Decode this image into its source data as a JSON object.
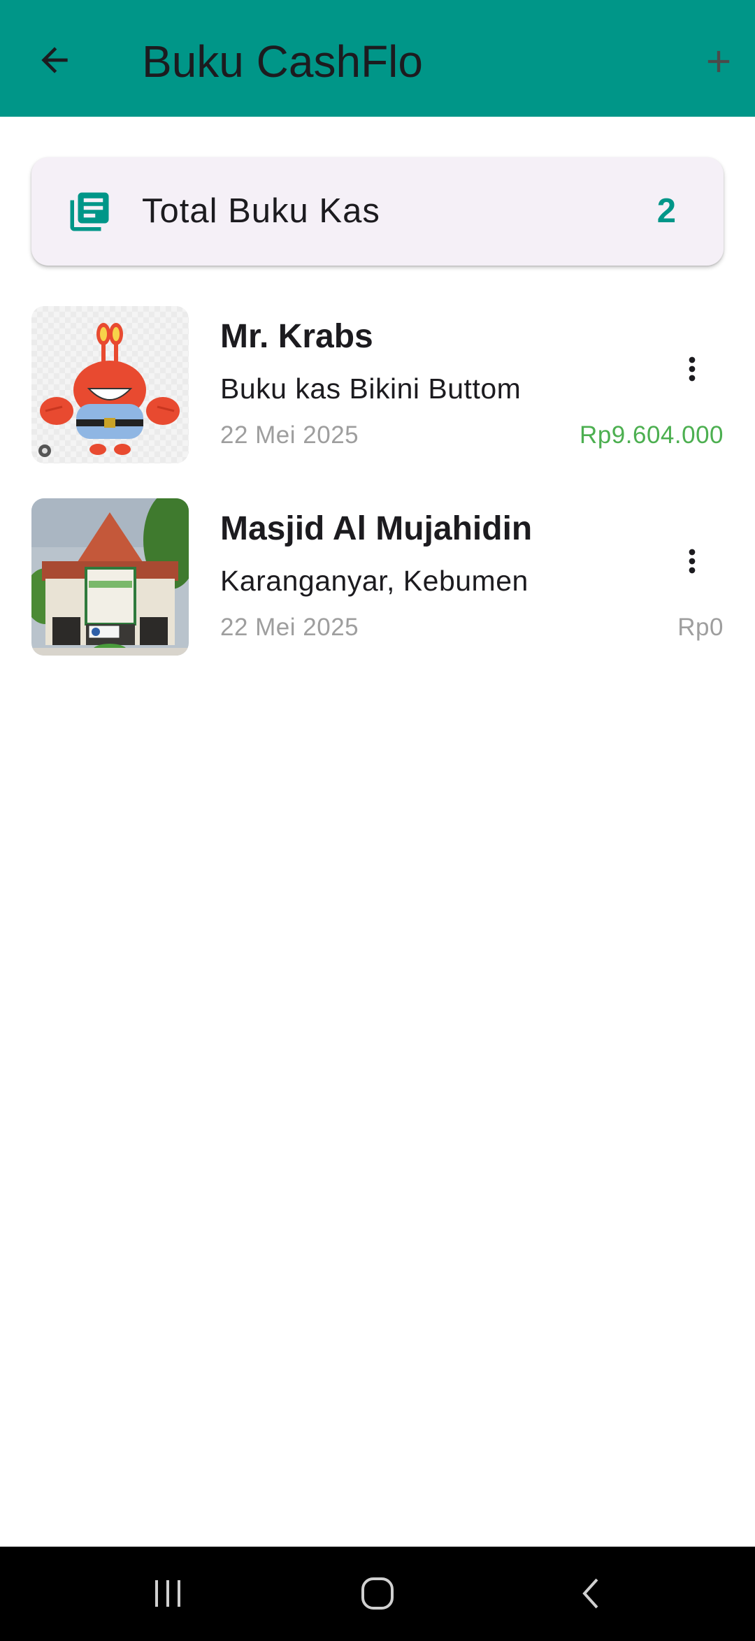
{
  "app_bar": {
    "title": "Buku CashFlo",
    "background_color": "#009688",
    "back_icon": "arrow-left-icon",
    "add_icon": "plus-icon"
  },
  "summary": {
    "icon": "library-books-icon",
    "label": "Total Buku Kas",
    "count": "2",
    "accent_color": "#009688"
  },
  "cashbooks": [
    {
      "thumbnail": "mr-krabs-cartoon-image",
      "name": "Mr. Krabs",
      "description": "Buku kas Bikini Buttom",
      "date": "22 Mei 2025",
      "balance": "Rp9.604.000",
      "balance_color": "#4caf50",
      "menu_icon": "more-vertical-icon"
    },
    {
      "thumbnail": "mosque-building-photo",
      "name": "Masjid Al Mujahidin",
      "description": "Karanganyar, Kebumen",
      "date": "22 Mei 2025",
      "balance": "Rp0",
      "balance_color": "#9e9e9e",
      "menu_icon": "more-vertical-icon"
    }
  ],
  "system_nav": {
    "recents_icon": "recent-apps-icon",
    "home_icon": "home-icon",
    "back_icon": "system-back-icon"
  }
}
